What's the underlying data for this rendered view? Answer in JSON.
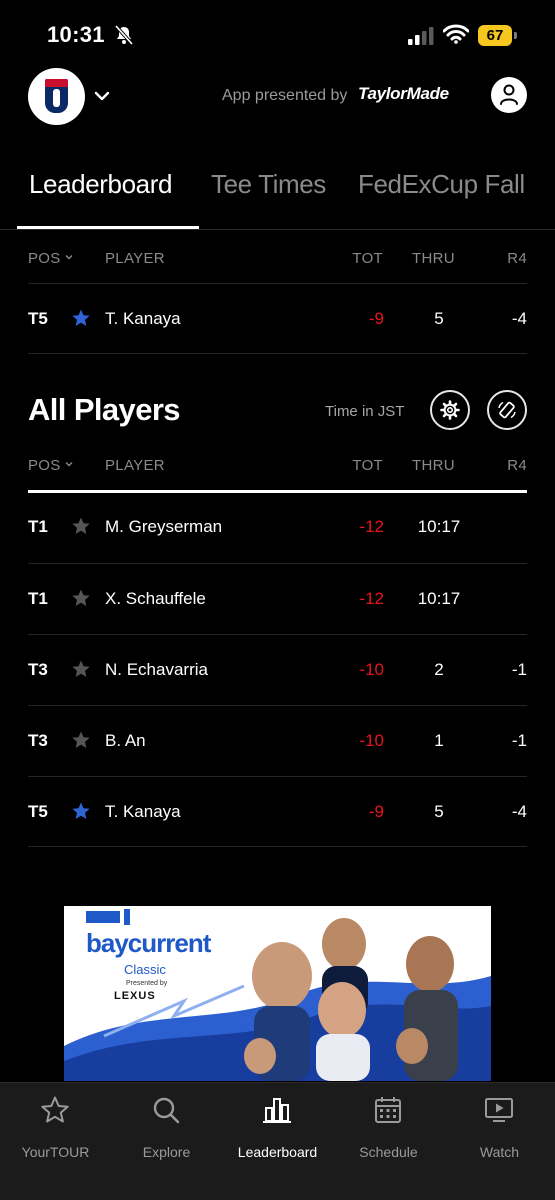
{
  "status_bar": {
    "time": "10:31",
    "battery": "67"
  },
  "header": {
    "presented_text": "App presented by",
    "sponsor": "TaylorMade"
  },
  "tabs": [
    {
      "label": "Leaderboard",
      "active": true
    },
    {
      "label": "Tee Times",
      "active": false
    },
    {
      "label": "FedExCup Fall",
      "active": false
    }
  ],
  "columns": {
    "pos": "POS",
    "player": "PLAYER",
    "tot": "TOT",
    "thru": "THRU",
    "r4": "R4"
  },
  "favorites": [
    {
      "pos": "T5",
      "starred": true,
      "name": "T. Kanaya",
      "tot": "-9",
      "thru": "5",
      "r4": "-4"
    }
  ],
  "all_players": {
    "title": "All Players",
    "timezone": "Time in JST",
    "rows": [
      {
        "pos": "T1",
        "starred": false,
        "name": "M. Greyserman",
        "tot": "-12",
        "thru": "10:17",
        "r4": ""
      },
      {
        "pos": "T1",
        "starred": false,
        "name": "X. Schauffele",
        "tot": "-12",
        "thru": "10:17",
        "r4": ""
      },
      {
        "pos": "T3",
        "starred": false,
        "name": "N. Echavarria",
        "tot": "-10",
        "thru": "2",
        "r4": "-1"
      },
      {
        "pos": "T3",
        "starred": false,
        "name": "B. An",
        "tot": "-10",
        "thru": "1",
        "r4": "-1"
      },
      {
        "pos": "T5",
        "starred": true,
        "name": "T. Kanaya",
        "tot": "-9",
        "thru": "5",
        "r4": "-4"
      }
    ]
  },
  "ad": {
    "brand": "baycurrent",
    "event": "Classic",
    "presented_by": "Presented by",
    "sponsor": "LEXUS"
  },
  "nav": [
    {
      "label": "YourTOUR",
      "icon": "star-icon",
      "active": false
    },
    {
      "label": "Explore",
      "icon": "search-icon",
      "active": false
    },
    {
      "label": "Leaderboard",
      "icon": "bar-chart-icon",
      "active": true
    },
    {
      "label": "Schedule",
      "icon": "calendar-icon",
      "active": false
    },
    {
      "label": "Watch",
      "icon": "play-icon",
      "active": false
    }
  ],
  "colors": {
    "under_par": "#e8141c",
    "favorite_star": "#2f63d6",
    "inactive_star": "#555555",
    "battery": "#f6c81f"
  }
}
